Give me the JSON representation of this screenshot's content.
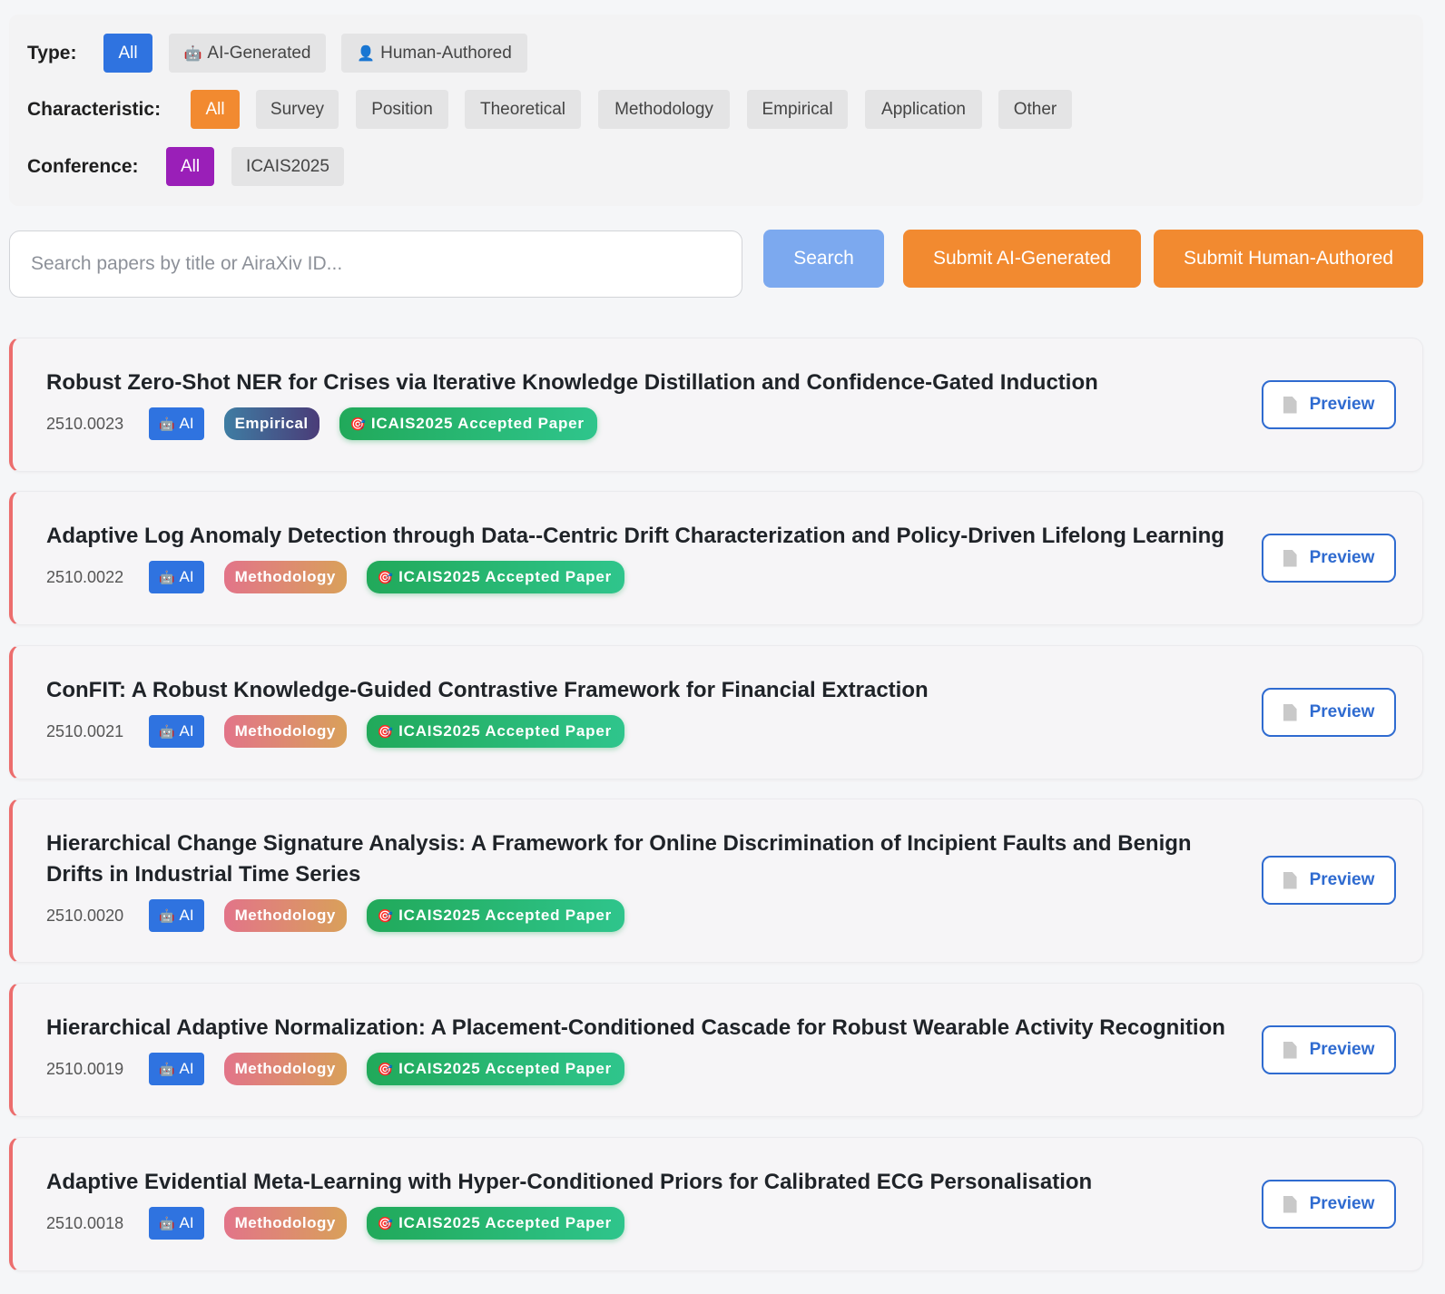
{
  "filters": {
    "type": {
      "label": "Type:",
      "options": [
        {
          "label": "All",
          "icon": "",
          "active": true
        },
        {
          "label": "AI-Generated",
          "icon": "🤖",
          "active": false
        },
        {
          "label": "Human-Authored",
          "icon": "👤",
          "active": false
        }
      ]
    },
    "characteristic": {
      "label": "Characteristic:",
      "options": [
        "All",
        "Survey",
        "Position",
        "Theoretical",
        "Methodology",
        "Empirical",
        "Application",
        "Other"
      ],
      "active": "All"
    },
    "conference": {
      "label": "Conference:",
      "options": [
        "All",
        "ICAIS2025"
      ],
      "active": "All"
    }
  },
  "search": {
    "placeholder": "Search papers by title or AiraXiv ID...",
    "value": "",
    "button_label": "Search"
  },
  "submit": {
    "ai_label": "Submit AI-Generated",
    "human_label": "Submit Human-Authored"
  },
  "papers": [
    {
      "title": "Robust Zero-Shot NER for Crises via Iterative Knowledge Distillation and Confidence-Gated Induction",
      "id": "2510.0023",
      "type_badge": "AI",
      "type_icon": "🤖",
      "characteristic": "Empirical",
      "conference_badge": "ICAIS2025 Accepted Paper",
      "conference_icon": "🎯",
      "preview_label": "Preview"
    },
    {
      "title": "Adaptive Log Anomaly Detection through Data--Centric Drift Characterization and Policy-Driven Lifelong Learning",
      "id": "2510.0022",
      "type_badge": "AI",
      "type_icon": "🤖",
      "characteristic": "Methodology",
      "conference_badge": "ICAIS2025 Accepted Paper",
      "conference_icon": "🎯",
      "preview_label": "Preview"
    },
    {
      "title": "ConFIT: A Robust Knowledge-Guided Contrastive Framework for Financial Extraction",
      "id": "2510.0021",
      "type_badge": "AI",
      "type_icon": "🤖",
      "characteristic": "Methodology",
      "conference_badge": "ICAIS2025 Accepted Paper",
      "conference_icon": "🎯",
      "preview_label": "Preview"
    },
    {
      "title": "Hierarchical Change Signature Analysis: A Framework for Online Discrimination of Incipient Faults and Benign Drifts in Industrial Time Series",
      "id": "2510.0020",
      "type_badge": "AI",
      "type_icon": "🤖",
      "characteristic": "Methodology",
      "conference_badge": "ICAIS2025 Accepted Paper",
      "conference_icon": "🎯",
      "preview_label": "Preview"
    },
    {
      "title": "Hierarchical Adaptive Normalization: A Placement-Conditioned Cascade for Robust Wearable Activity Recognition",
      "id": "2510.0019",
      "type_badge": "AI",
      "type_icon": "🤖",
      "characteristic": "Methodology",
      "conference_badge": "ICAIS2025 Accepted Paper",
      "conference_icon": "🎯",
      "preview_label": "Preview"
    },
    {
      "title": "Adaptive Evidential Meta-Learning with Hyper-Conditioned Priors for Calibrated ECG Personalisation",
      "id": "2510.0018",
      "type_badge": "AI",
      "type_icon": "🤖",
      "characteristic": "Methodology",
      "conference_badge": "ICAIS2025 Accepted Paper",
      "conference_icon": "🎯",
      "preview_label": "Preview"
    }
  ]
}
